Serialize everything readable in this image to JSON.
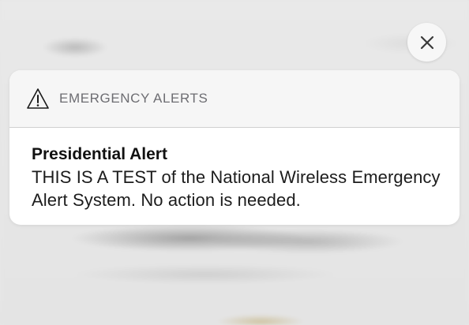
{
  "notification": {
    "app_name": "EMERGENCY ALERTS",
    "title": "Presidential Alert",
    "message": "THIS IS A TEST of the National Wireless Emergency Alert System. No action is needed.",
    "app_icon": "warning-triangle-icon"
  },
  "controls": {
    "close_icon": "close-icon"
  },
  "colors": {
    "card_background": "#ffffff",
    "header_background": "#f6f6f6",
    "app_name_text": "#6d6d72",
    "body_text": "#1c1c1c"
  }
}
